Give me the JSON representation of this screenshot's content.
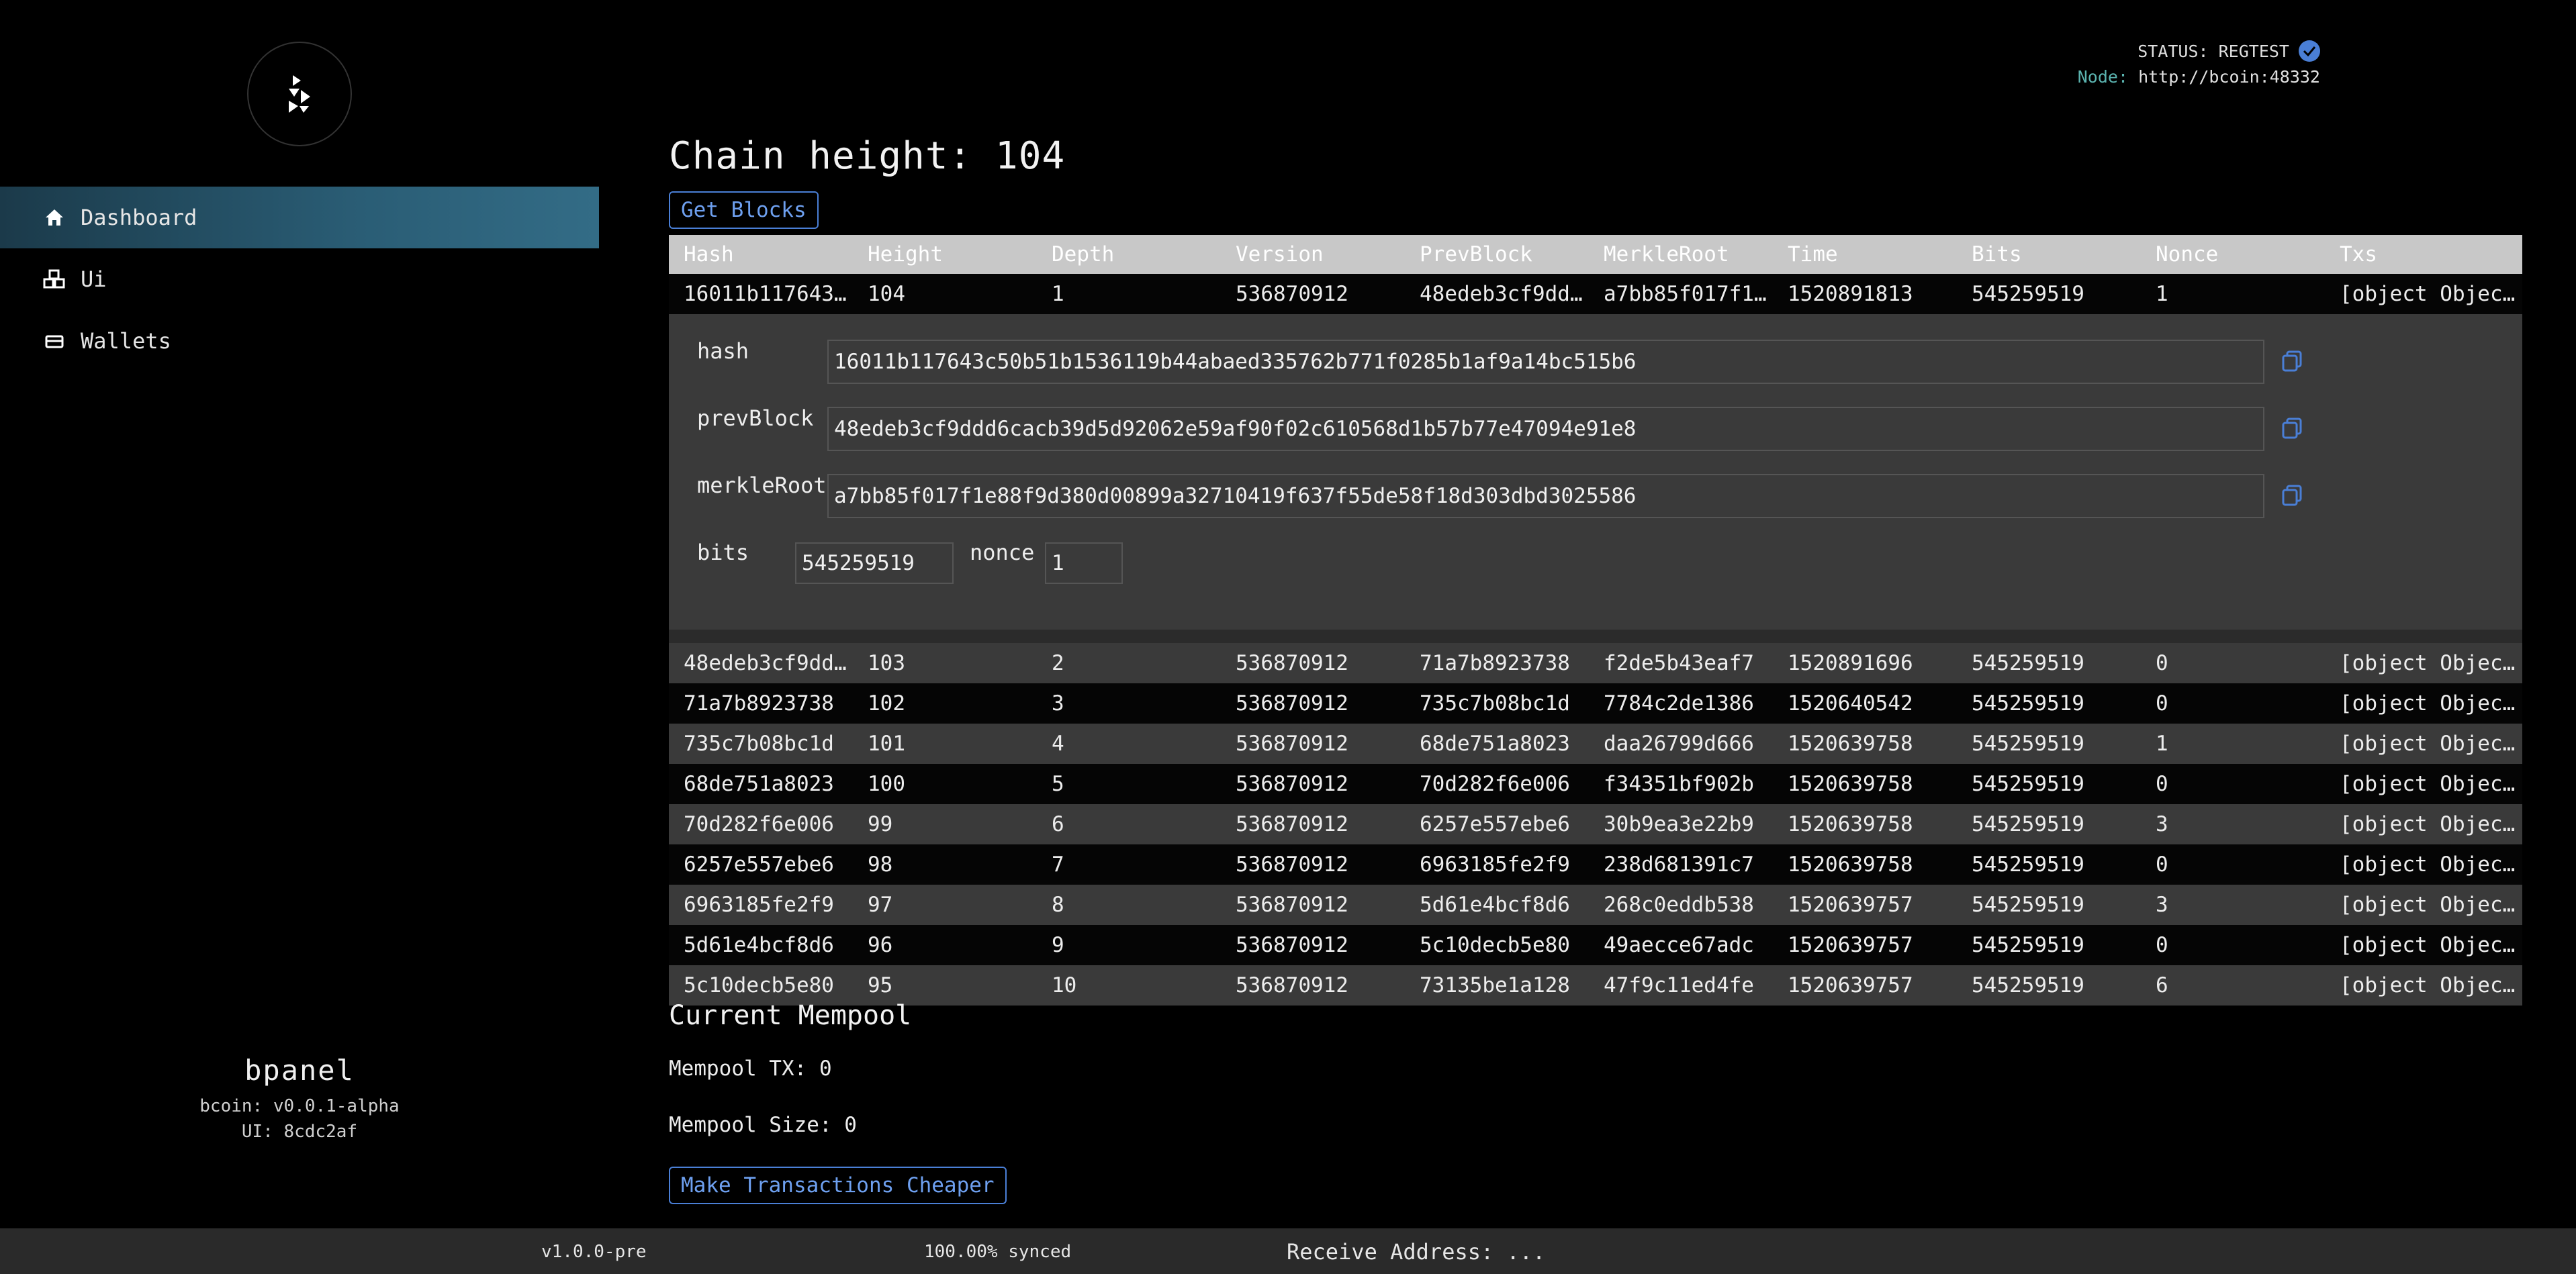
{
  "sidebar": {
    "logo": "bpanel-logo-icon",
    "items": [
      {
        "label": "Dashboard",
        "icon": "home-icon",
        "active": true
      },
      {
        "label": "Ui",
        "icon": "cubes-icon",
        "active": false
      },
      {
        "label": "Wallets",
        "icon": "wallet-icon",
        "active": false
      }
    ],
    "brand_name": "bpanel",
    "bcoin_version": "bcoin: v0.0.1-alpha",
    "ui_version": "UI: 8cdc2af"
  },
  "status": {
    "status_text": "STATUS: REGTEST",
    "node_label": "Node:",
    "node_url": "http://bcoin:48332"
  },
  "main": {
    "chain_height": "Chain height: 104",
    "get_blocks_label": "Get Blocks",
    "columns": [
      "Hash",
      "Height",
      "Depth",
      "Version",
      "PrevBlock",
      "MerkleRoot",
      "Time",
      "Bits",
      "Nonce",
      "Txs"
    ],
    "first_row": [
      "16011b117643c50b51b1536119b44abaed335762b771f0285b1af9a14bc515b6",
      "104",
      "1",
      "536870912",
      "48edeb3cf9ddd6cacb39d5d92062e59af90f02c610568d1b57b77e47094e91e8",
      "a7bb85f017f1e88f9d380d00899a32710419f637f55de58f18d303dbd3025586",
      "1520891813",
      "545259519",
      "1",
      "[object Object]"
    ],
    "detail": {
      "hash_label": "hash",
      "hash": "16011b117643c50b51b1536119b44abaed335762b771f0285b1af9a14bc515b6",
      "prevblock_label": "prevBlock",
      "prevblock": "48edeb3cf9ddd6cacb39d5d92062e59af90f02c610568d1b57b77e47094e91e8",
      "merkleroot_label": "merkleRoot",
      "merkleroot": "a7bb85f017f1e88f9d380d00899a32710419f637f55de58f18d303dbd3025586",
      "bits_label": "bits",
      "bits": "545259519",
      "nonce_label": "nonce",
      "nonce": "1"
    },
    "rows": [
      [
        "48edeb3cf9ddd6cacb39d5d92062e59af90f02c610568d1b57b77e47094e91e8",
        "103",
        "2",
        "536870912",
        "71a7b8923738",
        "f2de5b43eaf7",
        "1520891696",
        "545259519",
        "0",
        "[object Object]"
      ],
      [
        "71a7b8923738",
        "102",
        "3",
        "536870912",
        "735c7b08bc1d",
        "7784c2de1386",
        "1520640542",
        "545259519",
        "0",
        "[object Object]"
      ],
      [
        "735c7b08bc1d",
        "101",
        "4",
        "536870912",
        "68de751a8023",
        "daa26799d666",
        "1520639758",
        "545259519",
        "1",
        "[object Object]"
      ],
      [
        "68de751a8023",
        "100",
        "5",
        "536870912",
        "70d282f6e006",
        "f34351bf902b",
        "1520639758",
        "545259519",
        "0",
        "[object Object]"
      ],
      [
        "70d282f6e006",
        "99",
        "6",
        "536870912",
        "6257e557ebe6",
        "30b9ea3e22b9",
        "1520639758",
        "545259519",
        "3",
        "[object Object]"
      ],
      [
        "6257e557ebe6",
        "98",
        "7",
        "536870912",
        "6963185fe2f9",
        "238d681391c7",
        "1520639758",
        "545259519",
        "0",
        "[object Object]"
      ],
      [
        "6963185fe2f9",
        "97",
        "8",
        "536870912",
        "5d61e4bcf8d6",
        "268c0eddb538",
        "1520639757",
        "545259519",
        "3",
        "[object Object]"
      ],
      [
        "5d61e4bcf8d6",
        "96",
        "9",
        "536870912",
        "5c10decb5e80",
        "49aecce67adc",
        "1520639757",
        "545259519",
        "0",
        "[object Object]"
      ],
      [
        "5c10decb5e80",
        "95",
        "10",
        "536870912",
        "73135be1a128",
        "47f9c11ed4fe",
        "1520639757",
        "545259519",
        "6",
        "[object Object]"
      ]
    ]
  },
  "mempool": {
    "title": "Current Mempool",
    "tx": "Mempool TX: 0",
    "size": "Mempool Size: 0",
    "cheaper_label": "Make Transactions Cheaper"
  },
  "footer": {
    "version": "v1.0.0-pre",
    "synced": "100.00% synced",
    "receive": "Receive Address: ..."
  },
  "colors": {
    "accent": "#4a7fd6",
    "active_nav": "#2a5d75",
    "node_label": "#5bb4b0"
  }
}
